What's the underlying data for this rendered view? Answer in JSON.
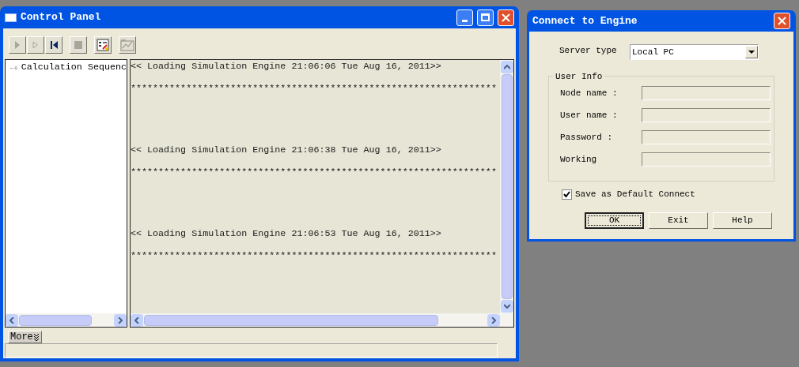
{
  "control_panel": {
    "title": "Control Panel",
    "toolbar": [
      {
        "kind": "run",
        "disabled": true
      },
      {
        "kind": "step",
        "disabled": true
      },
      {
        "kind": "rewind",
        "disabled": false
      },
      {
        "kind": "stop",
        "disabled": true
      },
      {
        "kind": "checklist",
        "disabled": false
      },
      {
        "kind": "results",
        "disabled": true
      }
    ],
    "tree": {
      "items": [
        {
          "label": "Calculation Sequenc"
        }
      ]
    },
    "log": [
      {
        "kind": "message",
        "text": "<< Loading Simulation Engine 21:06:06 Tue Aug 16, 2011>>"
      },
      {
        "kind": "separator",
        "text": "******************************************************************"
      },
      {
        "kind": "message",
        "text": "<< Loading Simulation Engine 21:06:38 Tue Aug 16, 2011>>"
      },
      {
        "kind": "separator",
        "text": "******************************************************************"
      },
      {
        "kind": "message",
        "text": "<< Loading Simulation Engine 21:06:53 Tue Aug 16, 2011>>"
      },
      {
        "kind": "separator",
        "text": "******************************************************************"
      }
    ],
    "more_button": "More"
  },
  "dialog": {
    "title": "Connect to Engine",
    "server_type": {
      "label": "Server type",
      "value": "Local PC"
    },
    "group": "User Info",
    "fields": [
      {
        "label": "Node name :"
      },
      {
        "label": "User name :"
      },
      {
        "label": "Password :"
      },
      {
        "label": "Working"
      }
    ],
    "save_default": {
      "label": "Save as Default Connect",
      "checked": true
    },
    "buttons": [
      {
        "label": "OK",
        "default": true
      },
      {
        "label": "Exit",
        "default": false
      },
      {
        "label": "Help",
        "default": false
      }
    ]
  }
}
